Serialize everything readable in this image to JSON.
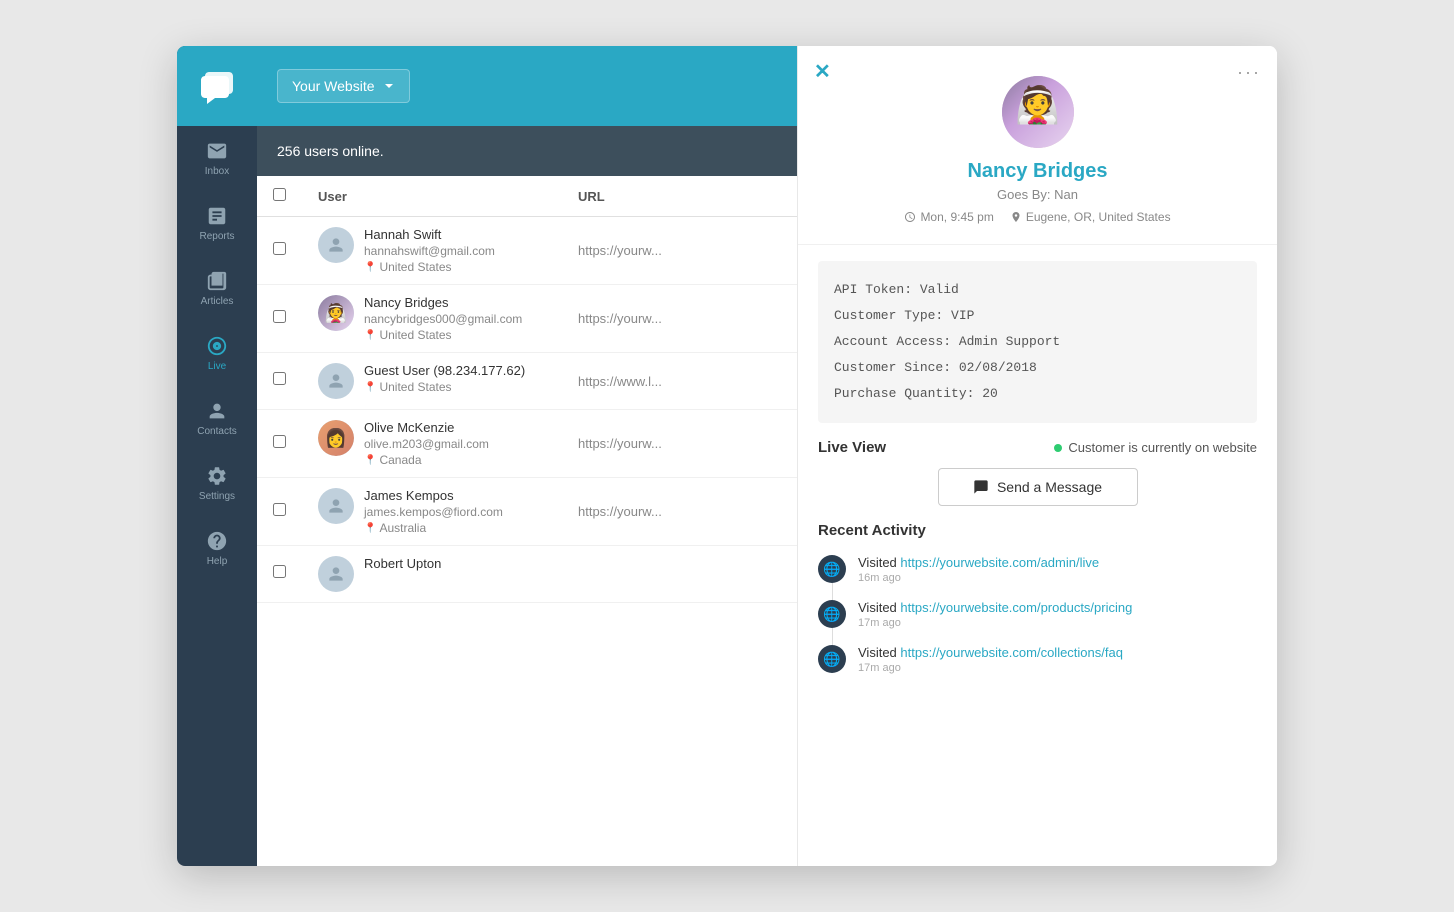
{
  "app": {
    "title": "Your Website",
    "dropdown_arrow": "▾"
  },
  "header": {
    "users_online": "256 users online."
  },
  "sidebar": {
    "logo_icon": "chat-logo-icon",
    "items": [
      {
        "id": "inbox",
        "label": "Inbox",
        "icon": "inbox-icon"
      },
      {
        "id": "reports",
        "label": "Reports",
        "icon": "reports-icon"
      },
      {
        "id": "articles",
        "label": "Articles",
        "icon": "articles-icon"
      },
      {
        "id": "live",
        "label": "Live",
        "icon": "live-icon",
        "active": true
      },
      {
        "id": "contacts",
        "label": "Contacts",
        "icon": "contacts-icon"
      },
      {
        "id": "settings",
        "label": "Settings",
        "icon": "settings-icon"
      },
      {
        "id": "help",
        "label": "Help",
        "icon": "help-icon"
      }
    ]
  },
  "table": {
    "columns": [
      "",
      "User",
      "URL"
    ],
    "rows": [
      {
        "name": "Hannah Swift",
        "email": "hannahswift@gmail.com",
        "location": "United States",
        "url": "https://yourw...",
        "avatar_type": "default"
      },
      {
        "name": "Nancy Bridges",
        "email": "nancybridges000@gmail.com",
        "location": "United States",
        "url": "https://yourw...",
        "avatar_type": "nancy"
      },
      {
        "name": "Guest User (98.234.177.62)",
        "email": "",
        "location": "United States",
        "url": "https://www.l...",
        "avatar_type": "default"
      },
      {
        "name": "Olive McKenzie",
        "email": "olive.m203@gmail.com",
        "location": "Canada",
        "url": "https://yourw...",
        "avatar_type": "olive"
      },
      {
        "name": "James Kempos",
        "email": "james.kempos@fiord.com",
        "location": "Australia",
        "url": "https://yourw...",
        "avatar_type": "default"
      },
      {
        "name": "Robert Upton",
        "email": "",
        "location": "",
        "url": "",
        "avatar_type": "default"
      }
    ]
  },
  "profile": {
    "name": "Nancy Bridges",
    "alias": "Goes By: Nan",
    "time": "Mon, 9:45 pm",
    "location": "Eugene, OR, United States",
    "customer_info": [
      "API Token: Valid",
      "Customer Type: VIP",
      "Account Access: Admin Support",
      "Customer Since: 02/08/2018",
      "Purchase Quantity: 20"
    ]
  },
  "live_view": {
    "title": "Live View",
    "status": "Customer is currently on website",
    "send_message_label": "Send a Message"
  },
  "recent_activity": {
    "title": "Recent Activity",
    "items": [
      {
        "action": "Visited",
        "url": "https://yourwebsite.com/admin/live",
        "time": "16m ago"
      },
      {
        "action": "Visited",
        "url": "https://yourwebsite.com/products/pricing",
        "time": "17m ago"
      },
      {
        "action": "Visited",
        "url": "https://yourwebsite.com/collections/faq",
        "time": "17m ago"
      }
    ]
  }
}
